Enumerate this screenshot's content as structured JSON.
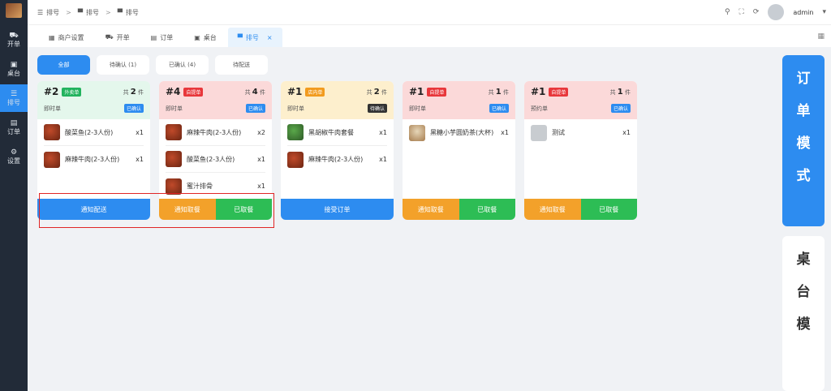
{
  "sidebar": {
    "items": [
      {
        "label": "开单",
        "icon": "cart-icon"
      },
      {
        "label": "桌台",
        "icon": "table-icon"
      },
      {
        "label": "排号",
        "icon": "list-icon"
      },
      {
        "label": "订单",
        "icon": "order-icon"
      },
      {
        "label": "设置",
        "icon": "gear-icon"
      }
    ]
  },
  "breadcrumb": [
    "排号",
    "排号",
    "排号"
  ],
  "header": {
    "user": "admin"
  },
  "tabs": [
    {
      "label": "商户设置"
    },
    {
      "label": "开单"
    },
    {
      "label": "订单"
    },
    {
      "label": "桌台"
    },
    {
      "label": "排号",
      "close": "×"
    }
  ],
  "filters": [
    "全部",
    "待确认 (1)",
    "已确认 (4)",
    "待配送"
  ],
  "cards": [
    {
      "num": "#2",
      "tag": "外卖单",
      "count_prefix": "共",
      "count": "2",
      "count_suffix": "件",
      "type": "即时单",
      "status": "已确认",
      "items": [
        {
          "name": "酸菜鱼(2-3人份)",
          "qty": "x1"
        },
        {
          "name": "麻辣牛肉(2-3人份)",
          "qty": "x1"
        }
      ],
      "buttons": [
        "通知配送"
      ]
    },
    {
      "num": "#4",
      "tag": "自提单",
      "count_prefix": "共",
      "count": "4",
      "count_suffix": "件",
      "type": "即时单",
      "status": "已确认",
      "items": [
        {
          "name": "麻辣牛肉(2-3人份)",
          "qty": "x2"
        },
        {
          "name": "酸菜鱼(2-3人份)",
          "qty": "x1"
        },
        {
          "name": "蜜汁排骨",
          "qty": "x1"
        }
      ],
      "buttons": [
        "通知取餐",
        "已取餐"
      ]
    },
    {
      "num": "#1",
      "tag": "店内单",
      "count_prefix": "共",
      "count": "2",
      "count_suffix": "件",
      "type": "即时单",
      "status": "待确认",
      "items": [
        {
          "name": "黑胡椒牛肉套餐",
          "qty": "x1"
        },
        {
          "name": "麻辣牛肉(2-3人份)",
          "qty": "x1"
        }
      ],
      "buttons": [
        "接受订单"
      ]
    },
    {
      "num": "#1",
      "tag": "自提单",
      "count_prefix": "共",
      "count": "1",
      "count_suffix": "件",
      "type": "即时单",
      "status": "已确认",
      "items": [
        {
          "name": "黑糖小芋圆奶茶(大杯)",
          "qty": "x1"
        }
      ],
      "buttons": [
        "通知取餐",
        "已取餐"
      ]
    },
    {
      "num": "#1",
      "tag": "自提单",
      "count_prefix": "共",
      "count": "1",
      "count_suffix": "件",
      "type": "预约单",
      "status": "已确认",
      "items": [
        {
          "name": "测试",
          "qty": "x1"
        }
      ],
      "buttons": [
        "通知取餐",
        "已取餐"
      ]
    }
  ],
  "modes": {
    "order": [
      "订",
      "单",
      "模",
      "式"
    ],
    "table": [
      "桌",
      "台",
      "模"
    ]
  }
}
